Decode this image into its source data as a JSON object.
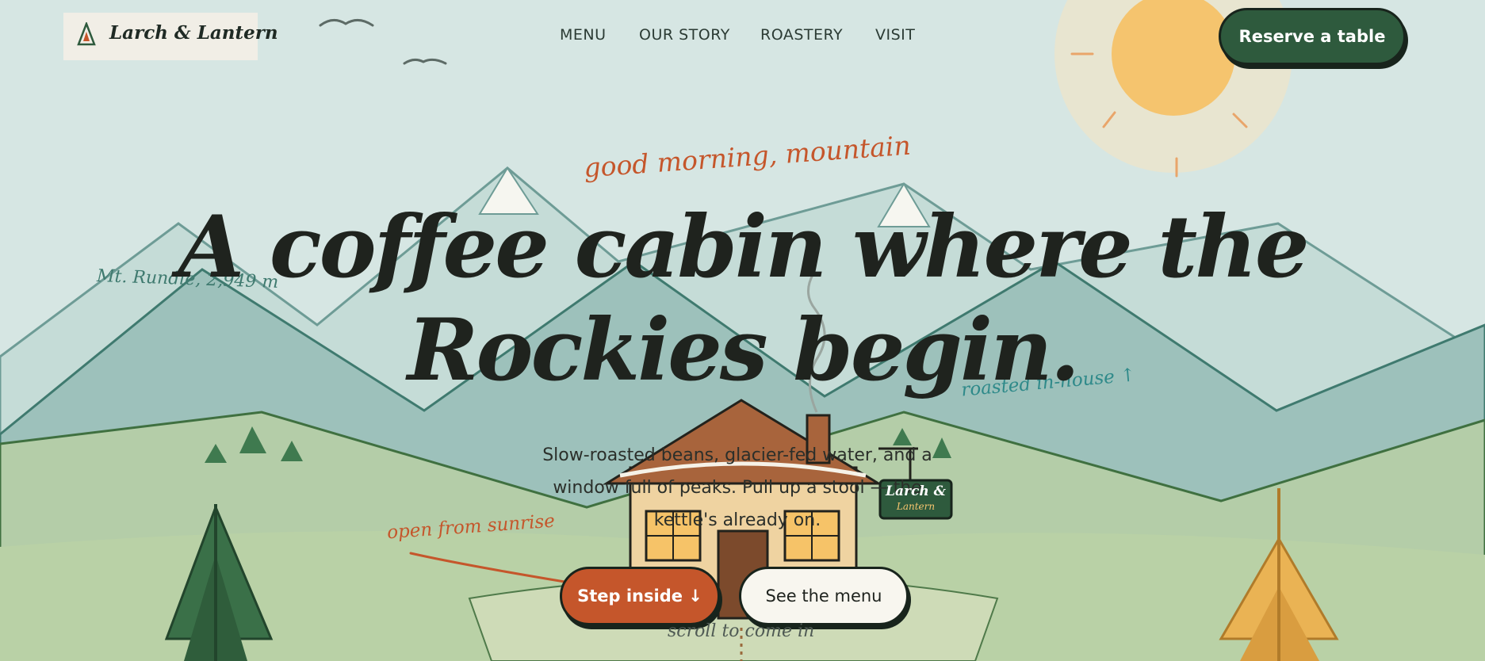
{
  "brand": {
    "name": "Larch & Lantern"
  },
  "nav": {
    "items": [
      "MENU",
      "OUR STORY",
      "ROASTERY",
      "VISIT"
    ]
  },
  "header": {
    "reserve_label": "Reserve a table"
  },
  "hero": {
    "eyebrow": "good morning, mountain",
    "headline_line1": "A coffee cabin where the",
    "headline_line2": "Rockies begin.",
    "subtitle": "Slow-roasted beans, glacier-fed water, and a window full of peaks. Pull up a stool — the kettle's already on.",
    "primary_label": "Step inside ↓",
    "secondary_label": "See the menu",
    "scroll_hint": "scroll to come in"
  },
  "annotations": {
    "mountain": "Mt. Rundle, 2,949 m",
    "roasted": "roasted in-house ↑",
    "open": "open from sunrise"
  },
  "sign": {
    "line1": "Larch &",
    "line2": "Lantern"
  },
  "colors": {
    "sky": "#d6e6e3",
    "accent": "#c5562b",
    "forest": "#2e5a3d",
    "sun": "#f5c46e",
    "ink": "#1f231e"
  }
}
